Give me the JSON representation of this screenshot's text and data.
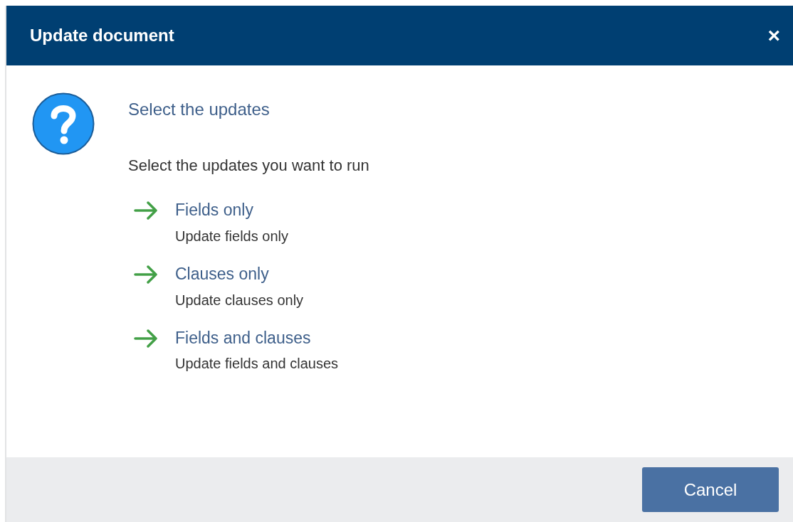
{
  "dialog": {
    "title": "Update document",
    "close_label": "×",
    "heading": "Select the updates",
    "message": "Select the updates you want to run",
    "options": [
      {
        "title": "Fields only",
        "description": "Update fields only"
      },
      {
        "title": "Clauses only",
        "description": "Update clauses only"
      },
      {
        "title": "Fields and clauses",
        "description": "Update fields and clauses"
      }
    ],
    "buttons": [
      "Cancel"
    ]
  }
}
